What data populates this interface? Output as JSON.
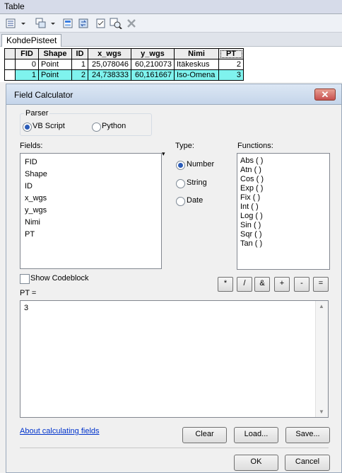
{
  "window": {
    "title": "Table"
  },
  "toolbar": {
    "icons": [
      "table-options-icon",
      "related-tables-icon",
      "select-by-attributes-icon",
      "switch-selection-icon",
      "clear-selection-icon",
      "zoom-to-selected-icon",
      "delete-selected-icon"
    ]
  },
  "tab": {
    "label": "KohdePisteet"
  },
  "table": {
    "columns": [
      "FID",
      "Shape",
      "ID",
      "x_wgs",
      "y_wgs",
      "Nimi",
      "PT"
    ],
    "rows": [
      {
        "FID": "0",
        "Shape": "Point",
        "ID": "1",
        "x_wgs": "25,078046",
        "y_wgs": "60,210073",
        "Nimi": "Itäkeskus",
        "PT": "2"
      },
      {
        "FID": "1",
        "Shape": "Point",
        "ID": "2",
        "x_wgs": "24,738333",
        "y_wgs": "60,161667",
        "Nimi": "Iso-Omena",
        "PT": "3"
      }
    ],
    "highlight_color": "#7ff3ee"
  },
  "dialog": {
    "title": "Field Calculator",
    "close_label": "✕",
    "parser": {
      "label": "Parser",
      "options": [
        "VB Script",
        "Python"
      ],
      "selected": "VB Script"
    },
    "fields": {
      "label": "Fields:",
      "items": [
        "FID",
        "Shape",
        "ID",
        "x_wgs",
        "y_wgs",
        "Nimi",
        "PT"
      ]
    },
    "type": {
      "label": "Type:",
      "options": [
        "Number",
        "String",
        "Date"
      ],
      "selected": "Number"
    },
    "functions": {
      "label": "Functions:",
      "items": [
        "Abs ( )",
        "Atn ( )",
        "Cos ( )",
        "Exp ( )",
        "Fix ( )",
        "Int ( )",
        "Log ( )",
        "Sin ( )",
        "Sqr ( )",
        "Tan ( )"
      ]
    },
    "show_codeblock": {
      "label": "Show Codeblock",
      "checked": false
    },
    "operators": [
      "*",
      "/",
      "&",
      "+",
      "-",
      "="
    ],
    "expression": {
      "label": "PT =",
      "value": "3"
    },
    "help_link": "About calculating fields",
    "buttons": {
      "clear": "Clear",
      "load": "Load...",
      "save": "Save...",
      "ok": "OK",
      "cancel": "Cancel"
    },
    "accent_close_color": "#c75050"
  }
}
